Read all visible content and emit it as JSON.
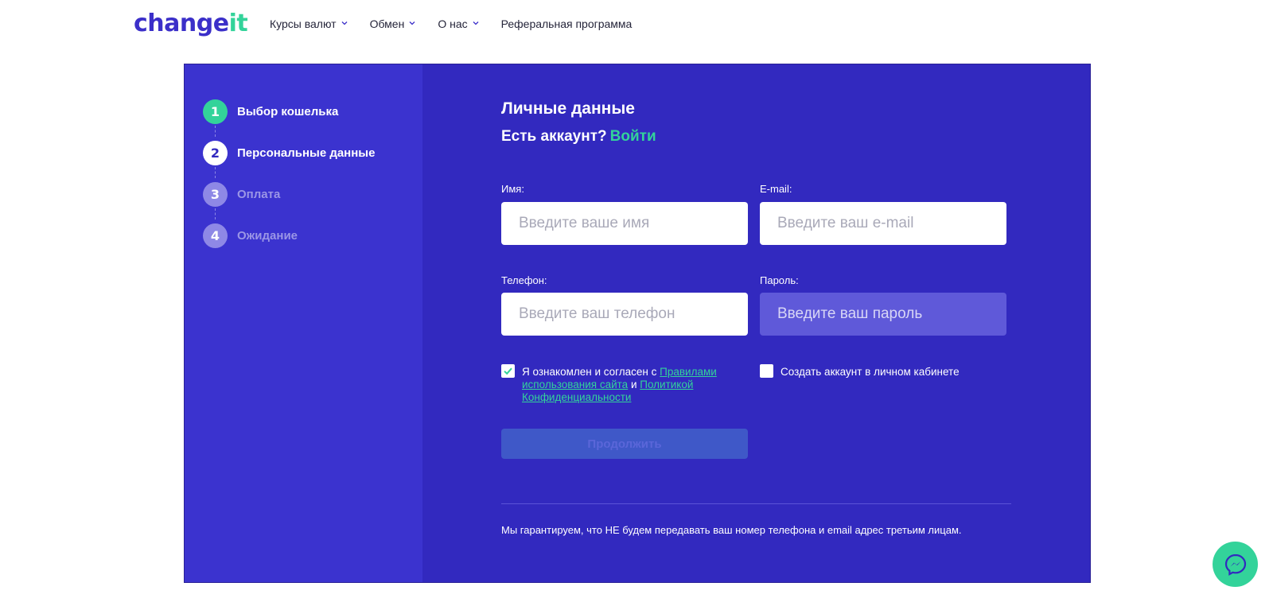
{
  "header": {
    "logo": {
      "part1": "change",
      "part2": "it"
    },
    "nav": [
      {
        "label": "Курсы валют",
        "has_dropdown": true
      },
      {
        "label": "Обмен",
        "has_dropdown": true
      },
      {
        "label": "О нас",
        "has_dropdown": true
      },
      {
        "label": "Реферальная программа",
        "has_dropdown": false
      }
    ]
  },
  "steps": [
    {
      "number": "1",
      "label": "Выбор кошелька",
      "state": "done"
    },
    {
      "number": "2",
      "label": "Персональные данные",
      "state": "active"
    },
    {
      "number": "3",
      "label": "Оплата",
      "state": "pending"
    },
    {
      "number": "4",
      "label": "Ожидание",
      "state": "pending"
    }
  ],
  "form": {
    "title": "Личные данные",
    "account_prompt": "Есть аккаунт?",
    "login_link": "Войти",
    "name": {
      "label": "Имя:",
      "placeholder": "Введите ваше имя",
      "value": ""
    },
    "email": {
      "label": "E-mail:",
      "placeholder": "Введите ваш e-mail",
      "value": ""
    },
    "phone": {
      "label": "Телефон:",
      "placeholder": "Введите ваш телефон",
      "value": ""
    },
    "password": {
      "label": "Пароль:",
      "placeholder": "Введите ваш пароль",
      "value": "",
      "disabled": true
    },
    "agree": {
      "checked": true,
      "text_before": "Я ознакомлен и согласен с ",
      "rules_link": "Правилами использования сайта",
      "text_and": " и ",
      "privacy_link": "Политикой Конфиденциальности"
    },
    "create_account": {
      "checked": false,
      "label": "Создать аккаунт в личном кабинете"
    },
    "submit_label": "Продолжить",
    "guarantee": "Мы гарантируем, что НЕ будем передавать ваш номер телефона и email адрес третьим лицам."
  },
  "colors": {
    "brand_dark": "#3b2fc9",
    "accent_green": "#33d39a",
    "card_bg": "#3229bf",
    "sidebar_bg": "#3b33cf"
  },
  "icons": {
    "nav_dropdown": "chevron-down-icon",
    "checkbox_checked": "checkmark-icon",
    "chat": "messenger-icon"
  }
}
